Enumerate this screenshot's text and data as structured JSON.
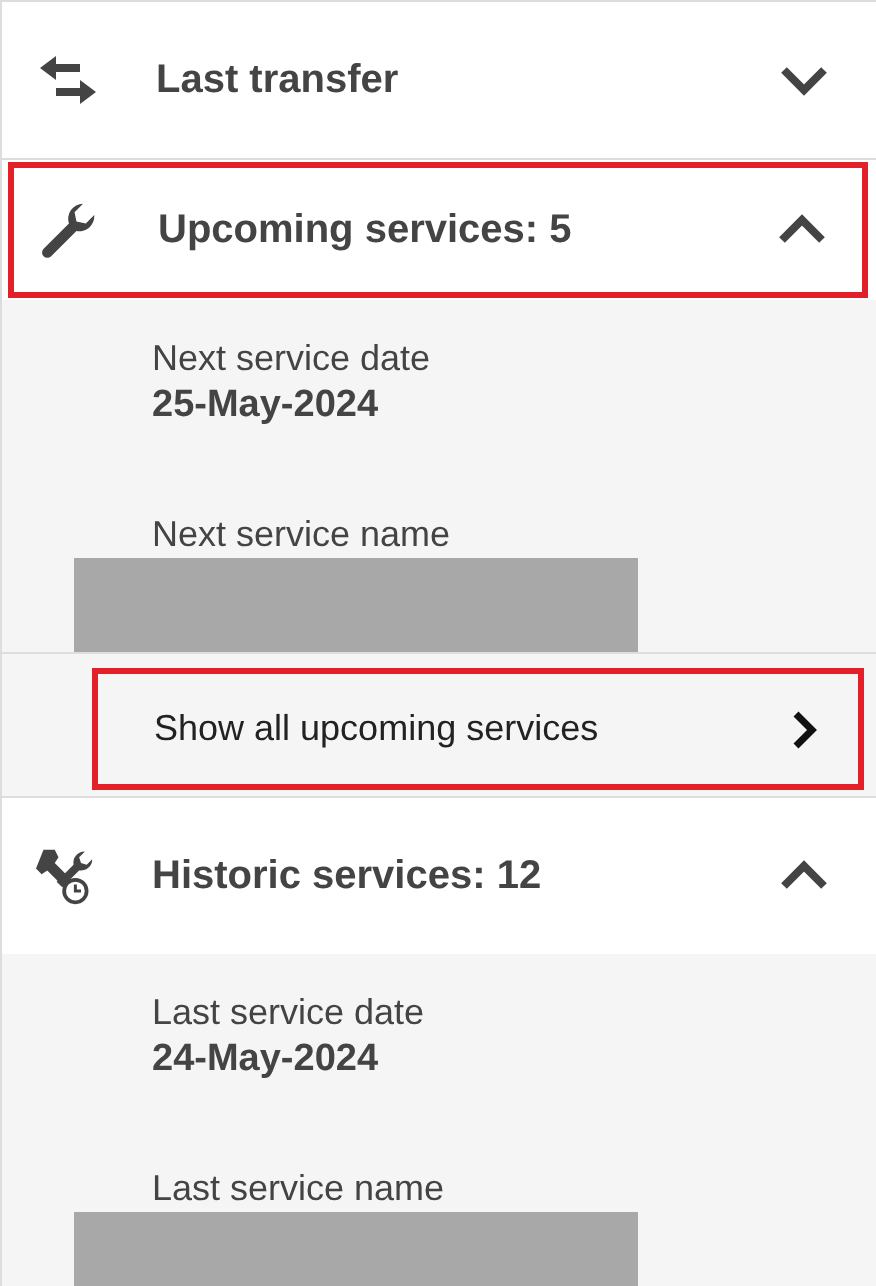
{
  "sections": [
    {
      "title": "Last transfer",
      "kind": "transfer",
      "expanded": false,
      "highlighted": false
    },
    {
      "title": "Upcoming services: 5",
      "kind": "upcoming",
      "expanded": true,
      "highlighted": true,
      "fields": [
        {
          "label": "Next service date",
          "kind": "text",
          "value": "25-May-2024"
        },
        {
          "label": "Next service name",
          "kind": "redacted"
        }
      ],
      "link": {
        "label": "Show all upcoming services",
        "highlighted": true
      }
    },
    {
      "title": "Historic services: 12",
      "kind": "historic",
      "expanded": true,
      "highlighted": false,
      "fields": [
        {
          "label": "Last service date",
          "kind": "text",
          "value": "24-May-2024"
        },
        {
          "label": "Last service name",
          "kind": "redacted"
        }
      ]
    }
  ]
}
